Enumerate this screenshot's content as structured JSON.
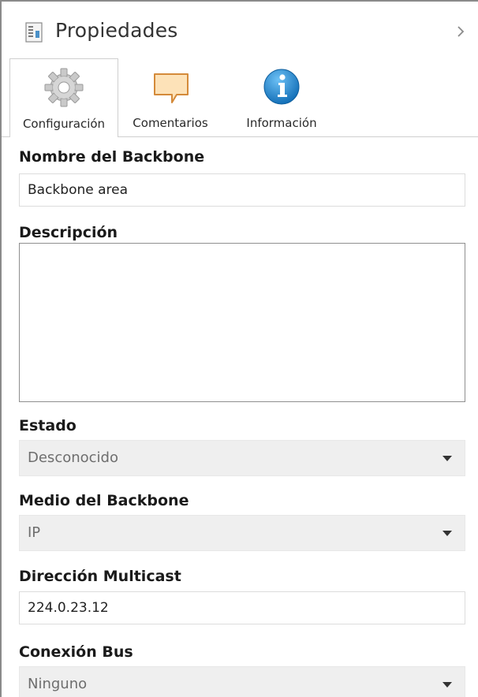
{
  "panel": {
    "title": "Propiedades",
    "icons": {
      "doc": "document-icon",
      "collapse": "chevron-right-icon"
    }
  },
  "tabs": [
    {
      "label": "Configuración",
      "icon": "gear-icon",
      "active": true
    },
    {
      "label": "Comentarios",
      "icon": "comment-icon",
      "active": false
    },
    {
      "label": "Información",
      "icon": "info-icon",
      "active": false
    }
  ],
  "form": {
    "backbone_name": {
      "label": "Nombre del Backbone",
      "value": "Backbone area"
    },
    "description": {
      "label": "Descripción",
      "value": ""
    },
    "state": {
      "label": "Estado",
      "value": "Desconocido"
    },
    "medium": {
      "label": "Medio del Backbone",
      "value": "IP"
    },
    "multicast": {
      "label": "Dirección Multicast",
      "value": "224.0.23.12"
    },
    "bus_connection": {
      "label": "Conexión Bus",
      "value": "Ninguno"
    }
  },
  "colors": {
    "info_blue": "#1f7fc8",
    "comment_orange": "#e8a04a",
    "select_bg": "#efefef"
  }
}
